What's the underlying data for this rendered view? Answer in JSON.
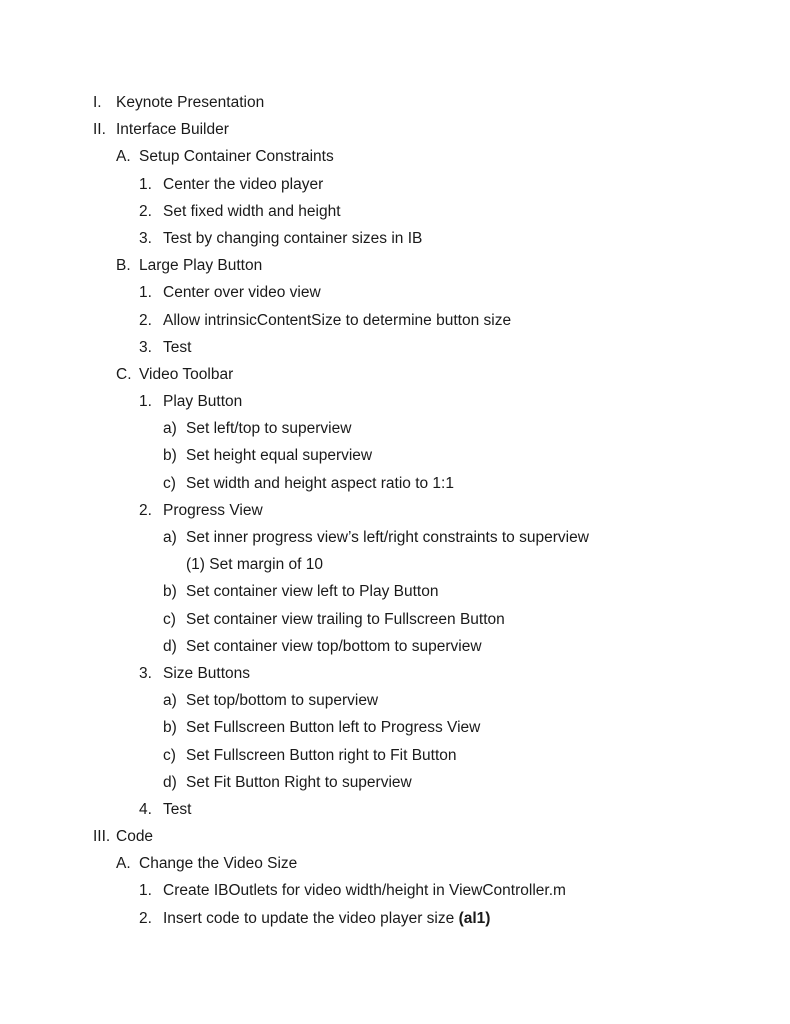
{
  "outline": [
    {
      "marker": "I.",
      "text": "Keynote Presentation"
    },
    {
      "marker": "II.",
      "text": "Interface Builder"
    },
    {
      "marker": "A.",
      "text": "Setup Container Constraints"
    },
    {
      "marker": "1.",
      "text": "Center the video player"
    },
    {
      "marker": "2.",
      "text": "Set fixed width and height"
    },
    {
      "marker": "3.",
      "text": "Test by changing container sizes in IB"
    },
    {
      "marker": "B.",
      "text": "Large Play Button"
    },
    {
      "marker": "1.",
      "text": "Center over video view"
    },
    {
      "marker": "2.",
      "text": "Allow intrinsicContentSize to determine button size"
    },
    {
      "marker": "3.",
      "text": "Test"
    },
    {
      "marker": "C.",
      "text": "Video Toolbar"
    },
    {
      "marker": "1.",
      "text": "Play Button"
    },
    {
      "marker": "a)",
      "text": "Set left/top to superview"
    },
    {
      "marker": "b)",
      "text": "Set height equal superview"
    },
    {
      "marker": "c)",
      "text": "Set width and height aspect ratio to 1:1"
    },
    {
      "marker": "2.",
      "text": "Progress View"
    },
    {
      "marker": "a)",
      "text": "Set inner progress view’s left/right constraints to superview"
    },
    {
      "marker": "",
      "text": "(1) Set margin of 10"
    },
    {
      "marker": "b)",
      "text": "Set container view left to Play Button"
    },
    {
      "marker": "c)",
      "text": "Set container view trailing to Fullscreen Button"
    },
    {
      "marker": "d)",
      "text": "Set container view top/bottom to superview"
    },
    {
      "marker": "3.",
      "text": "Size Buttons"
    },
    {
      "marker": "a)",
      "text": "Set top/bottom to superview"
    },
    {
      "marker": "b)",
      "text": "Set Fullscreen Button left to Progress View"
    },
    {
      "marker": "c)",
      "text": "Set Fullscreen Button right to Fit Button"
    },
    {
      "marker": "d)",
      "text": "Set Fit Button Right to superview"
    },
    {
      "marker": "4.",
      "text": "Test"
    },
    {
      "marker": "III.",
      "text": "Code"
    },
    {
      "marker": "A.",
      "text": "Change the Video Size"
    },
    {
      "marker": "1.",
      "text": "Create IBOutlets for video width/height in ViewController.m"
    },
    {
      "marker": "2.",
      "text": "Insert code to update the video player size",
      "bold": "(al1)"
    }
  ]
}
